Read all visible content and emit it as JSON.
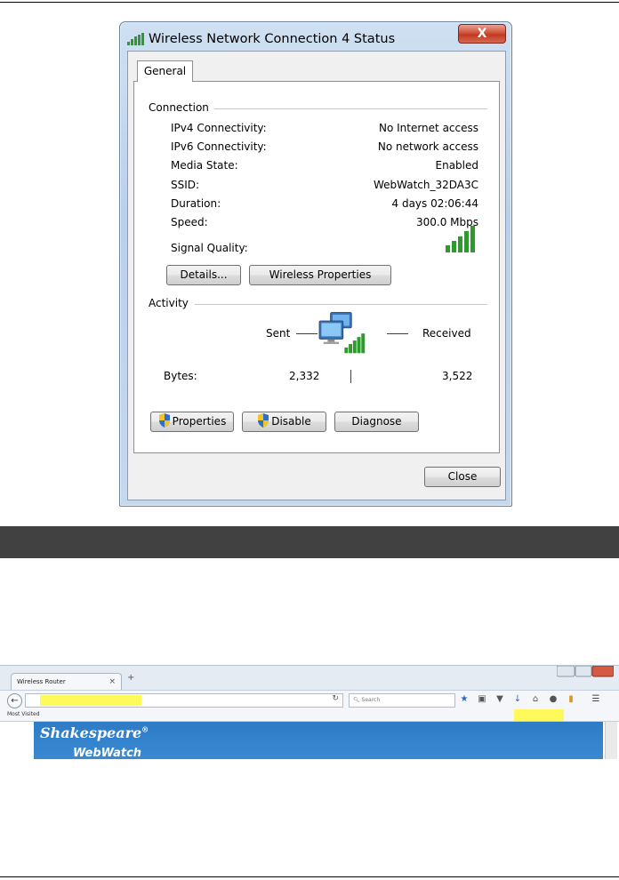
{
  "dialog": {
    "title": "Wireless Network Connection 4 Status",
    "close_glyph": "X",
    "tab_general": "General",
    "connection": {
      "heading": "Connection",
      "rows": [
        {
          "label": "IPv4 Connectivity:",
          "value": "No Internet access"
        },
        {
          "label": "IPv6 Connectivity:",
          "value": "No network access"
        },
        {
          "label": "Media State:",
          "value": "Enabled"
        },
        {
          "label": "SSID:",
          "value": "WebWatch_32DA3C"
        },
        {
          "label": "Duration:",
          "value": "4 days 02:06:44"
        },
        {
          "label": "Speed:",
          "value": "300.0 Mbps"
        }
      ],
      "signal_label": "Signal Quality:",
      "signal_bars": 5,
      "details_button": "Details...",
      "wireless_properties_button": "Wireless Properties"
    },
    "activity": {
      "heading": "Activity",
      "sent_label": "Sent",
      "received_label": "Received",
      "bytes_label": "Bytes:",
      "bytes_sent": "2,332",
      "bytes_received": "3,522"
    },
    "buttons": {
      "properties": "Properties",
      "disable": "Disable",
      "diagnose": "Diagnose",
      "close": "Close"
    },
    "colors": {
      "signal_green": "#2e9a2e",
      "close_red": "#c8462c"
    }
  },
  "browser": {
    "tab_title": "Wireless Router",
    "tab_close": "×",
    "new_tab": "+",
    "search_placeholder": "Search",
    "most_visited": "Most Visited",
    "page_brand": "Shakespeare",
    "page_brand_mark": "®",
    "page_product": "WebWatch",
    "highlight_color": "#fff95c"
  }
}
